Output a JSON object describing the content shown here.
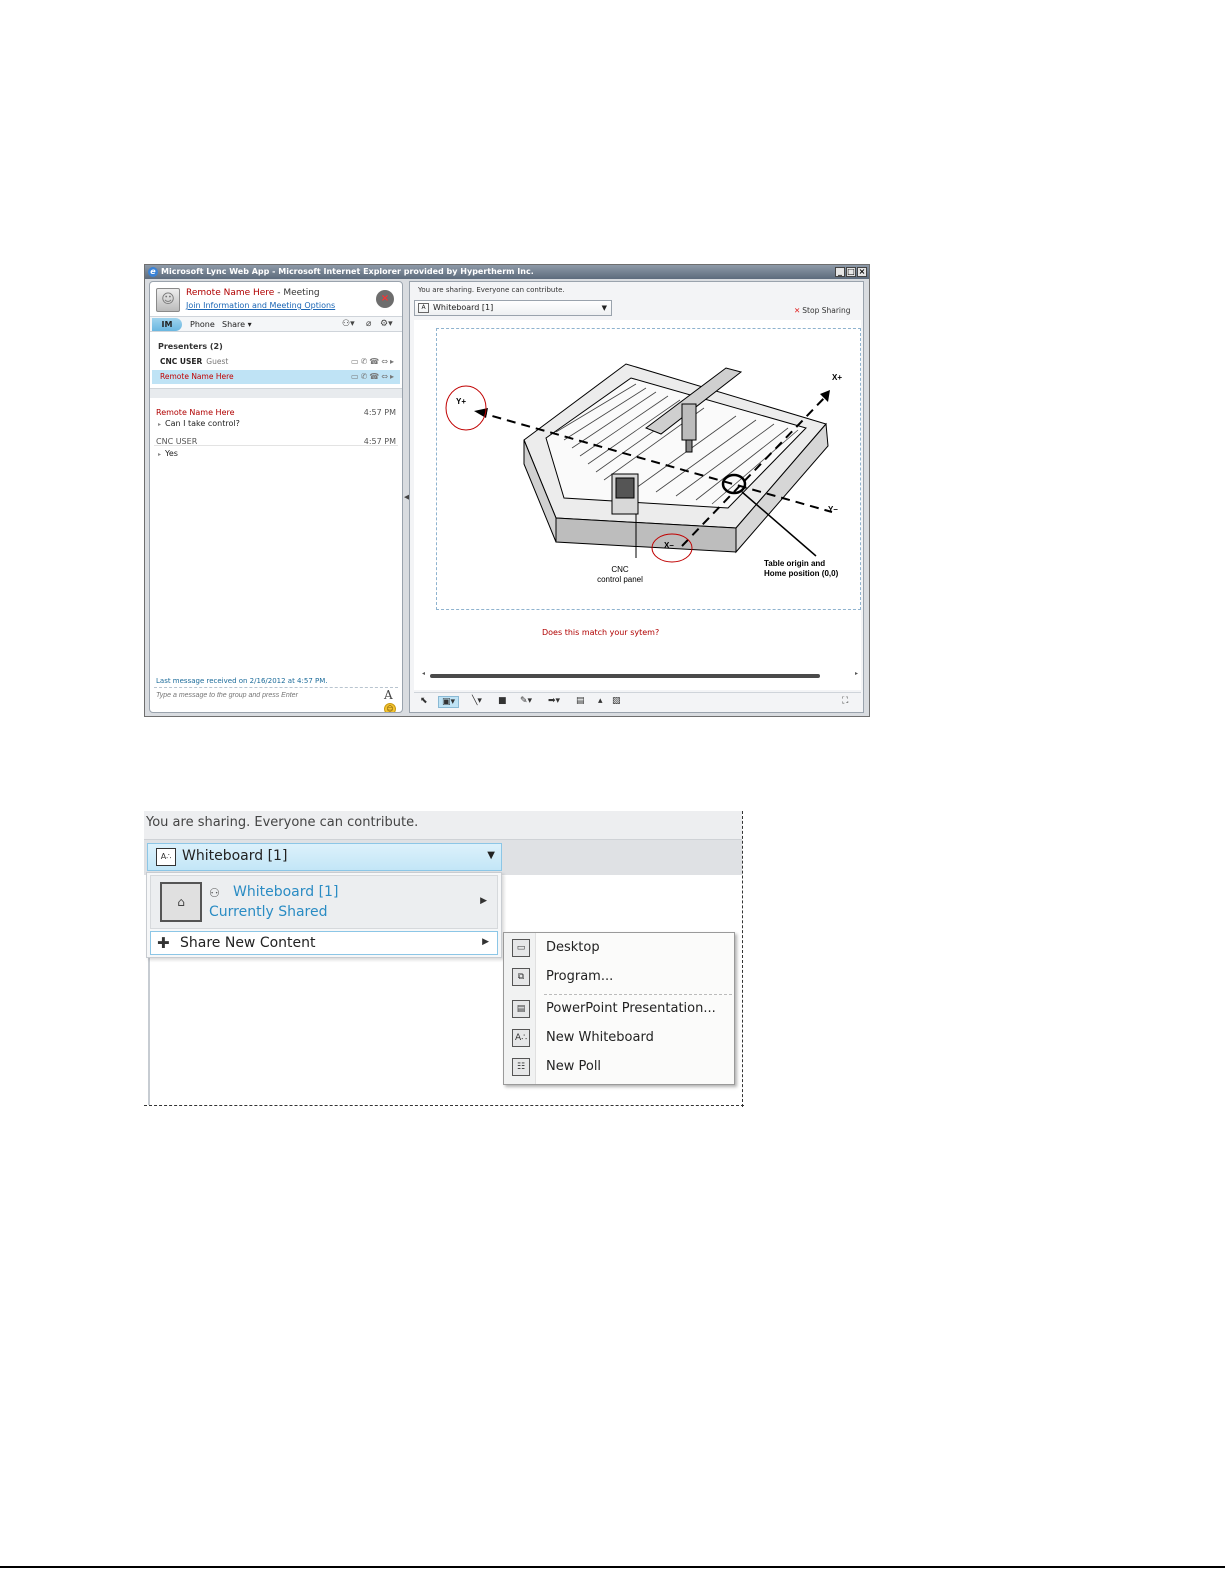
{
  "window": {
    "title": "Microsoft Lync Web App - Microsoft Internet Explorer provided by Hypertherm Inc.",
    "controls": [
      "_",
      "□",
      "×"
    ]
  },
  "conversation": {
    "name": "Remote Name Here",
    "separator": " - ",
    "type": "Meeting",
    "join_link": "Join Information and Meeting Options"
  },
  "modes": {
    "im": "IM",
    "phone": "Phone",
    "share": "Share ▾"
  },
  "presenters": {
    "heading": "Presenters (2)",
    "rows": [
      {
        "name": "CNC USER",
        "role": "Guest"
      },
      {
        "name": "Remote Name Here",
        "role": ""
      }
    ]
  },
  "chat": {
    "messages": [
      {
        "sender": "Remote Name Here",
        "time": "4:57 PM",
        "text": "Can I take control?"
      },
      {
        "sender": "CNC USER",
        "time": "4:57 PM",
        "text": "Yes"
      }
    ],
    "last_message": "Last message received on 2/16/2012 at 4:57 PM.",
    "input_placeholder": "Type a message to the group and press Enter",
    "font_icon": "A"
  },
  "stage": {
    "sharing_status": "You are sharing. Everyone can contribute.",
    "content_select": "Whiteboard [1]",
    "stop_sharing": "Stop Sharing",
    "question": "Does this match your sytem?"
  },
  "whiteboard": {
    "axis_y_plus": "Y+",
    "axis_x_plus": "X+",
    "axis_y_minus": "Y–",
    "axis_x_minus": "X–",
    "cnc_label_1": "CNC",
    "cnc_label_2": "control panel",
    "origin_label_1": "Table origin and",
    "origin_label_2": "Home position (0,0)"
  },
  "zoom": {
    "sharing_status": "You are sharing. Everyone can contribute.",
    "select_label": "Whiteboard [1]",
    "current_title": "Whiteboard [1]",
    "current_status": "Currently Shared",
    "share_new": "Share New Content",
    "submenu": [
      {
        "label": "Desktop",
        "icon": "desktop-icon"
      },
      {
        "label": "Program...",
        "icon": "program-icon"
      },
      {
        "label": "PowerPoint Presentation...",
        "icon": "powerpoint-icon"
      },
      {
        "label": "New Whiteboard",
        "icon": "whiteboard-icon"
      },
      {
        "label": "New Poll",
        "icon": "poll-icon"
      }
    ]
  },
  "colors": {
    "accent_blue": "#2a8cc4",
    "highlight": "#bfe3f5",
    "name_red": "#b00000",
    "stop_red": "#e02020"
  }
}
